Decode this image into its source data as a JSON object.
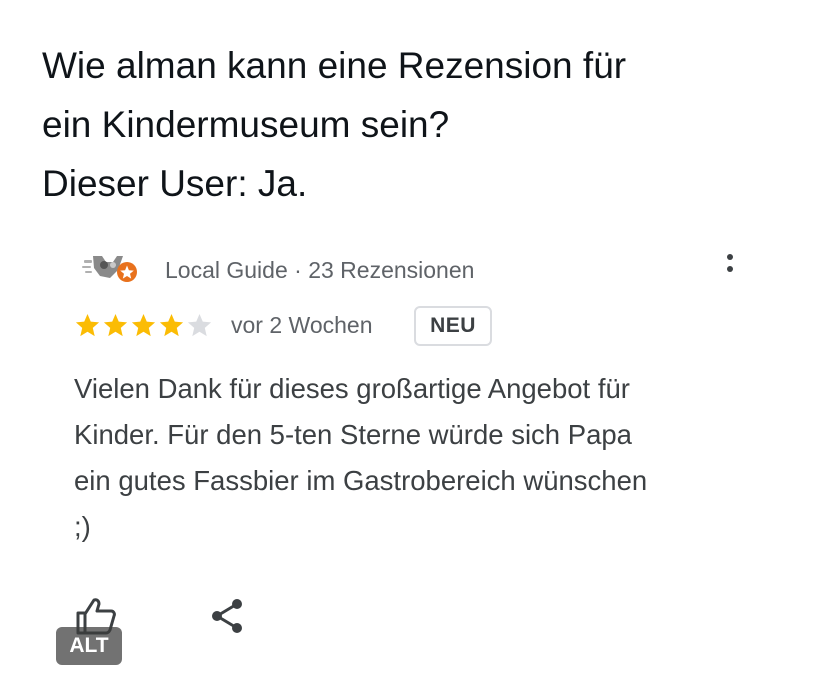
{
  "tweet": {
    "lines": [
      "Wie alman kann eine Rezension für",
      "ein Kindermuseum sein?",
      "Dieser User: Ja."
    ]
  },
  "review": {
    "avatar_icon": "local-guide-avatar-icon",
    "author_meta": "Local Guide · 23 Rezensionen",
    "rating": 4,
    "rating_max": 5,
    "star_filled_color": "#fbbc04",
    "star_empty_color": "#dadce0",
    "time": "vor 2 Wochen",
    "badge": "NEU",
    "body_lines": [
      "Vielen Dank für dieses großartige Angebot für",
      "Kinder. Für den 5-ten Sterne würde sich Papa",
      "ein gutes Fassbier im Gastrobereich wünschen",
      ";)"
    ],
    "actions": {
      "like_icon": "thumbs-up-icon",
      "share_icon": "share-icon",
      "more_icon": "more-vertical-icon"
    }
  },
  "media": {
    "alt_badge": "ALT"
  }
}
